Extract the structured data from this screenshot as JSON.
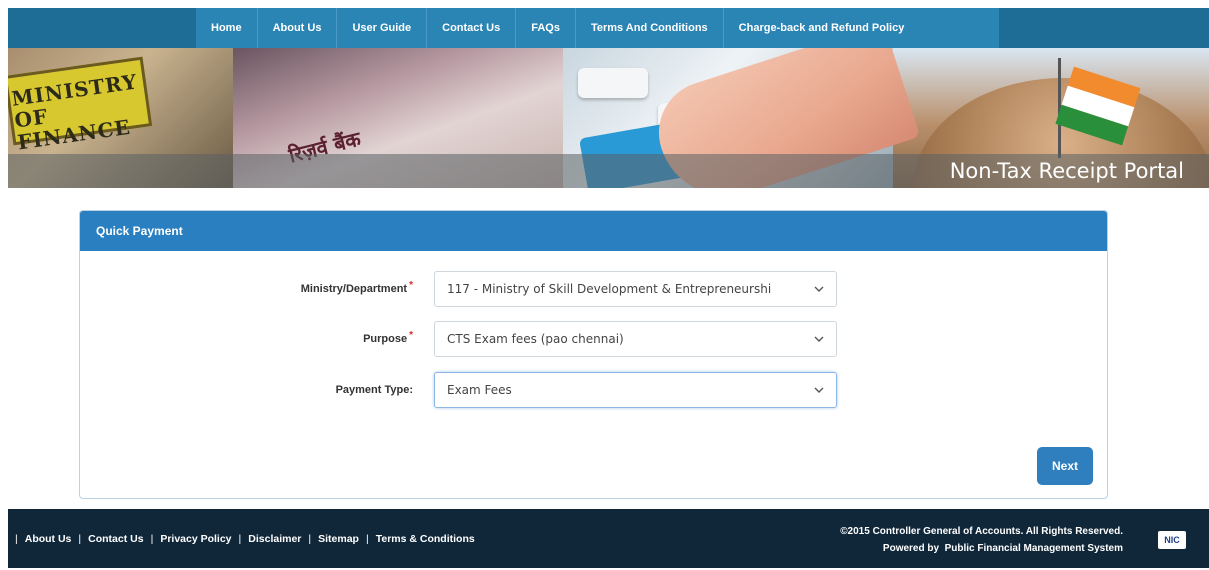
{
  "nav": {
    "items": [
      {
        "label": "Home"
      },
      {
        "label": "About Us"
      },
      {
        "label": "User Guide"
      },
      {
        "label": "Contact Us"
      },
      {
        "label": "FAQs"
      },
      {
        "label": "Terms And Conditions"
      },
      {
        "label": "Charge-back and Refund Policy"
      }
    ]
  },
  "banner": {
    "ministry_sign": "MINISTRY OF FINANCE",
    "note_text": "रिज़र्व बैंक",
    "portal_title": "Non-Tax Receipt Portal"
  },
  "panel": {
    "title": "Quick Payment",
    "fields": {
      "ministry": {
        "label": "Ministry/Department",
        "required_mark": "*",
        "value": "117 - Ministry of Skill Development & Entrepreneurshi"
      },
      "purpose": {
        "label": "Purpose",
        "required_mark": "*",
        "value": "CTS Exam fees (pao chennai)"
      },
      "payment_type": {
        "label": "Payment Type:",
        "value": "Exam Fees"
      }
    },
    "next_label": "Next"
  },
  "footer": {
    "links": [
      {
        "label": "About Us"
      },
      {
        "label": "Contact Us"
      },
      {
        "label": "Privacy Policy"
      },
      {
        "label": "Disclaimer"
      },
      {
        "label": "Sitemap"
      },
      {
        "label": "Terms & Conditions"
      }
    ],
    "copyright": "©2015 Controller General of Accounts. All Rights Reserved.",
    "powered_by": "Powered by  Public Financial Management System",
    "logo_text": "NIC"
  },
  "colors": {
    "nav_bg": "#1e6d96",
    "nav_active_bg": "#2a85b4",
    "panel_header": "#2a7fc0",
    "button": "#2f7fbf",
    "footer_bg": "#10273a",
    "required": "#d9302c"
  },
  "icons": {
    "select_chevron": "chevron-down-icon"
  }
}
